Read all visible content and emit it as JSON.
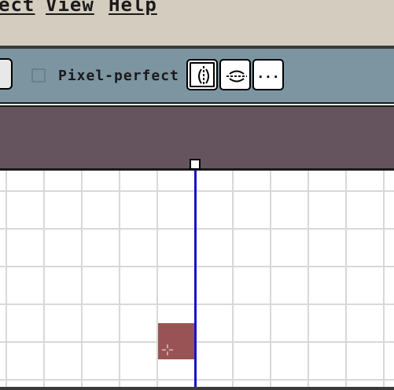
{
  "menubar": {
    "items": [
      {
        "label": "ect"
      },
      {
        "label": "View"
      },
      {
        "label": "Help"
      }
    ]
  },
  "toolbar": {
    "pixel_perfect_label": "Pixel-perfect",
    "pixel_perfect_checked": false,
    "more_button_label": "..."
  }
}
